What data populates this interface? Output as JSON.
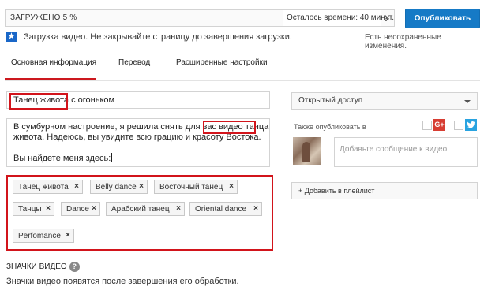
{
  "upload": {
    "status": "ЗАГРУЖЕНО 5 %",
    "time_left": "Осталось времени: 40 минут.",
    "close_icon": "close-icon"
  },
  "publish_label": "Опубликовать",
  "notice": {
    "icon": "star-icon",
    "icon_glyph": "★",
    "text": "Загрузка видео. Не закрывайте страницу до завершения загрузки.",
    "unsaved": "Есть несохраненные изменения."
  },
  "tabs": [
    {
      "label": "Основная информация",
      "active": true
    },
    {
      "label": "Перевод",
      "active": false
    },
    {
      "label": "Расширенные настройки",
      "active": false
    }
  ],
  "title": {
    "highlighted": "Танец живота",
    "rest": " с огоньком"
  },
  "description": {
    "line1_before": "В сумбурном настроение, я решила снять для вас ",
    "line1_highlighted": "видео танца",
    "line2": "живота. Надеюсь, вы увидите всю грацию и красоту Востока.",
    "line3": "Вы найдете меня здесь:"
  },
  "tags": [
    "Танец живота",
    "Belly dance",
    "Восточный танец",
    "Танцы",
    "Dance",
    "Арабский танец",
    "Oriental dance",
    "Perfomance"
  ],
  "tag_remove_glyph": "×",
  "thumbnails": {
    "title": "ЗНАЧКИ ВИДЕО",
    "help_glyph": "?",
    "text": "Значки видео появятся после завершения его обработки."
  },
  "privacy": {
    "selected": "Открытый доступ"
  },
  "share": {
    "label": "Также опубликовать в",
    "gplus_glyph": "G+",
    "twitter_glyph": "🐦",
    "message_placeholder": "Добавьте сообщение к видео"
  },
  "playlist_label": "+ Добавить в плейлист",
  "colors": {
    "accent": "#167ac6",
    "highlight": "#d2141b",
    "tab_active": "#cc181e"
  }
}
